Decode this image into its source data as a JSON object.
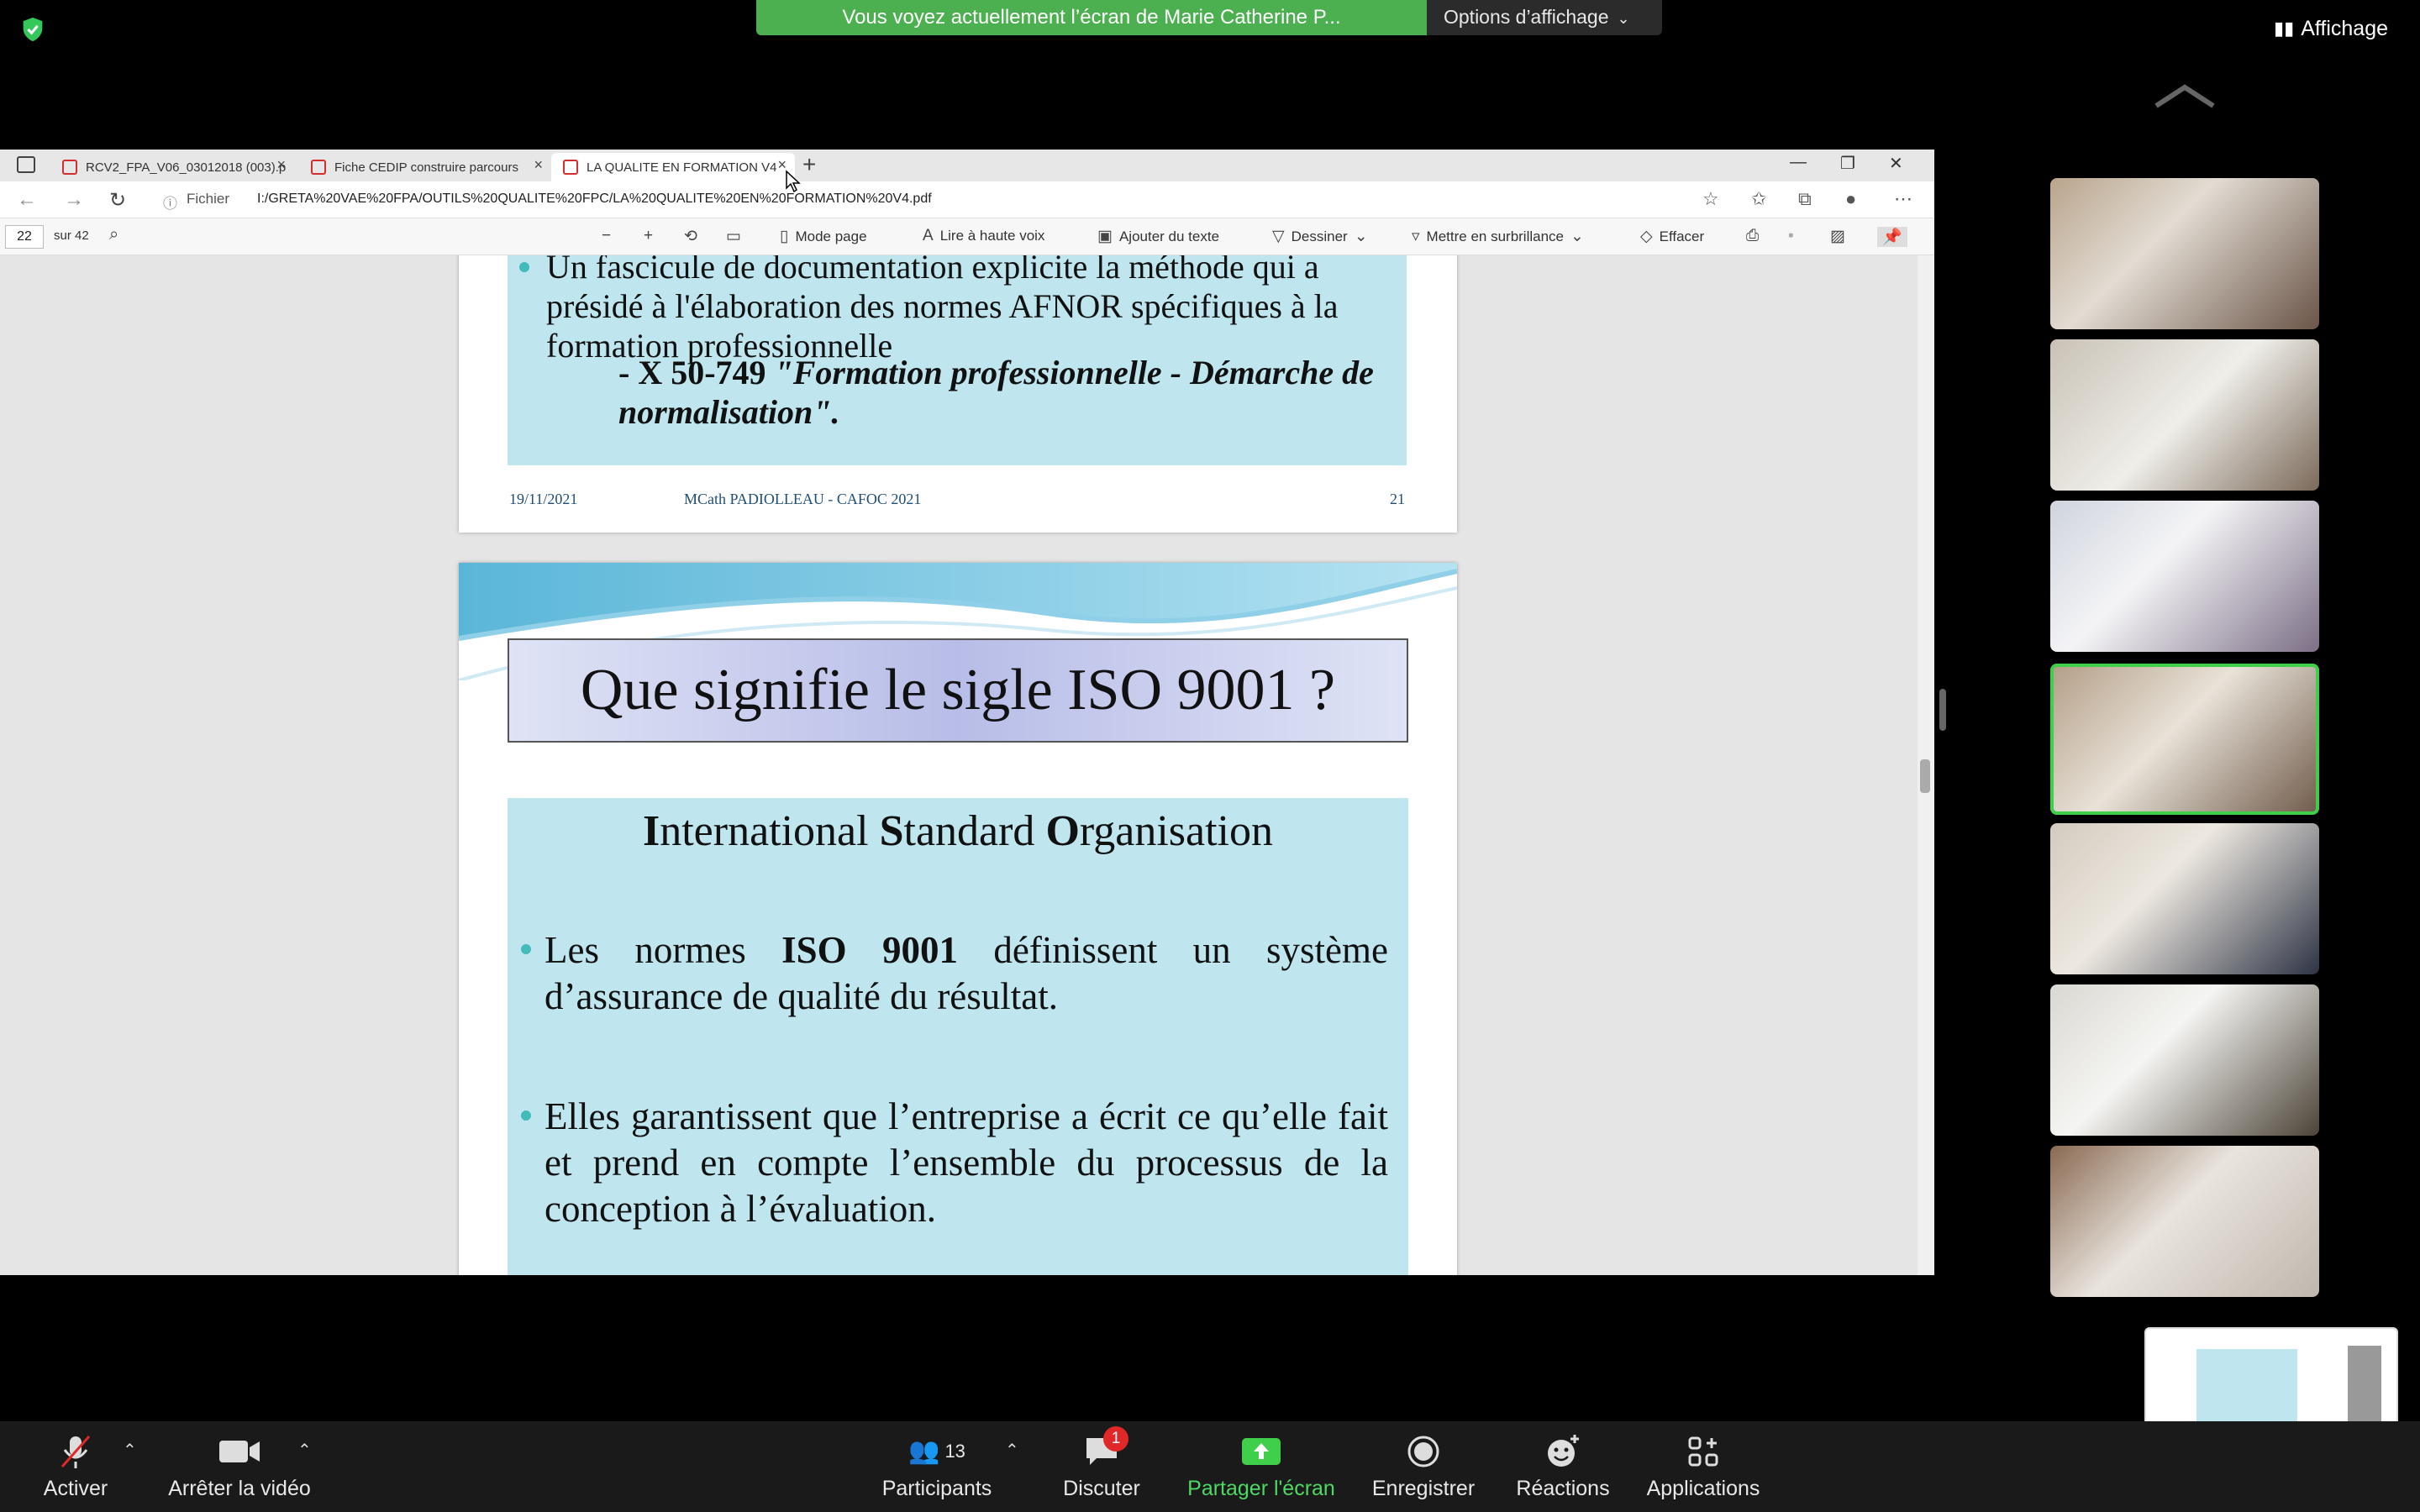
{
  "zoom_top": {
    "banner_text": "Vous voyez actuellement l’écran de Marie Catherine P...",
    "view_options": "Options d’affichage",
    "affichage": "Affichage"
  },
  "browser": {
    "tabs": [
      {
        "label": "RCV2_FPA_V06_03012018 (003).p"
      },
      {
        "label": "Fiche CEDIP construire parcours"
      },
      {
        "label": "LA QUALITE EN FORMATION V4"
      }
    ],
    "file_label": "Fichier",
    "url": "I:/GRETA%20VAE%20FPA/OUTILS%20QUALITE%20FPC/LA%20QUALITE%20EN%20FORMATION%20V4.pdf"
  },
  "pdf_toolbar": {
    "page_number": "22",
    "page_total": "sur 42",
    "mode_page": "Mode page",
    "read_aloud": "Lire à haute voix",
    "add_text": "Ajouter du texte",
    "draw": "Dessiner",
    "highlight": "Mettre en surbrillance",
    "erase": "Effacer"
  },
  "slide1": {
    "bullet_text": "Un fascicule de documentation explicite la méthode qui a présidé à l'élaboration des normes AFNOR spécifiques à la formation professionnelle",
    "sub_prefix": "- X 50-749 ",
    "sub_italic": "\"Formation professionnelle - Démarche de normalisation\".",
    "footer_date": "19/11/2021",
    "footer_author": "MCath PADIOLLEAU - CAFOC 2021",
    "footer_page": "21"
  },
  "slide2": {
    "title": "Que signifie le sigle ISO 9001 ?",
    "subtitle_parts": [
      "I",
      "nternational ",
      "S",
      "tandard ",
      "O",
      "rganisation"
    ],
    "bullet1_a": "Les normes ",
    "bullet1_b": "ISO 9001",
    "bullet1_c": " définissent un système d’assurance de qualité du résultat.",
    "bullet2": "Elles garantissent que l’entreprise  a écrit ce qu’elle fait et prend en compte l’ensemble du processus de la conception à l’évaluation."
  },
  "zoom_toolbar": {
    "mute": "Activer",
    "video": "Arrêter la vidéo",
    "participants": "Participants",
    "participants_count": "13",
    "chat": "Discuter",
    "chat_badge": "1",
    "share": "Partager l'écran",
    "record": "Enregistrer",
    "reactions": "Réactions",
    "apps": "Applications"
  },
  "colors": {
    "banner": "#4caf50",
    "share": "#4cd964",
    "slide_box": "#bfe6ee"
  }
}
